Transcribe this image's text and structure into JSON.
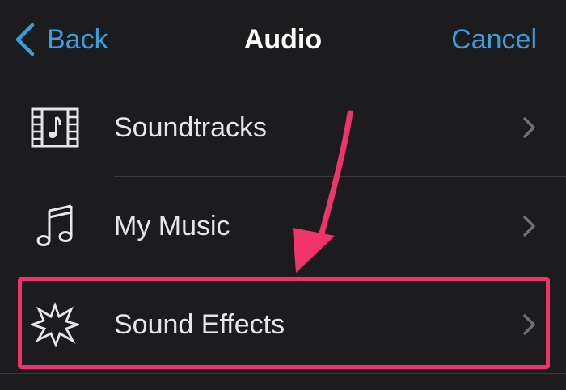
{
  "navbar": {
    "back_label": "Back",
    "title": "Audio",
    "cancel_label": "Cancel"
  },
  "menu": {
    "items": [
      {
        "label": "Soundtracks",
        "icon": "film-music-icon"
      },
      {
        "label": "My Music",
        "icon": "music-note-icon"
      },
      {
        "label": "Sound Effects",
        "icon": "starburst-icon"
      }
    ]
  },
  "colors": {
    "background": "#1c1c1e",
    "accent": "#3b9ddb",
    "annotation": "#f0346b",
    "separator": "#3a3a3c"
  }
}
